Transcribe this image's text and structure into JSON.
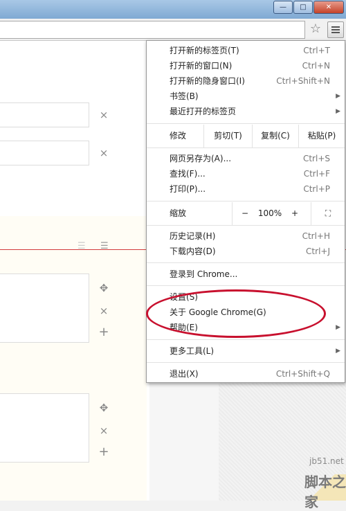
{
  "window": {
    "buttons": {
      "minimize": "—",
      "maximize": "□",
      "close": "✕"
    }
  },
  "toolbar": {
    "star_icon": "star-icon",
    "menu_icon": "hamburger-menu-icon"
  },
  "page": {
    "remove_glyph": "×",
    "add_glyph": "+",
    "move_glyph": "✥",
    "list_glyph": "☰"
  },
  "menu": {
    "items": [
      {
        "label": "打开新的标签页(T)",
        "shortcut": "Ctrl+T"
      },
      {
        "label": "打开新的窗口(N)",
        "shortcut": "Ctrl+N"
      },
      {
        "label": "打开新的隐身窗口(I)",
        "shortcut": "Ctrl+Shift+N"
      },
      {
        "label": "书签(B)",
        "submenu": "▶"
      },
      {
        "label": "最近打开的标签页",
        "submenu": "▶"
      }
    ],
    "edit": {
      "label": "修改",
      "cut": "剪切(T)",
      "copy": "复制(C)",
      "paste": "粘贴(P)"
    },
    "file_items": [
      {
        "label": "网页另存为(A)...",
        "shortcut": "Ctrl+S"
      },
      {
        "label": "查找(F)...",
        "shortcut": "Ctrl+F"
      },
      {
        "label": "打印(P)...",
        "shortcut": "Ctrl+P"
      }
    ],
    "zoom": {
      "label": "缩放",
      "minus": "−",
      "value": "100%",
      "plus": "+",
      "fullscreen": "⛶"
    },
    "history_items": [
      {
        "label": "历史记录(H)",
        "shortcut": "Ctrl+H"
      },
      {
        "label": "下载内容(D)",
        "shortcut": "Ctrl+J"
      }
    ],
    "signin": "登录到 Chrome...",
    "settings_items": [
      {
        "label": "设置(S)"
      },
      {
        "label": "关于 Google Chrome(G)"
      },
      {
        "label": "帮助(E)",
        "submenu": "▶"
      }
    ],
    "more_tools": {
      "label": "更多工具(L)",
      "submenu": "▶"
    },
    "exit": {
      "label": "退出(X)",
      "shortcut": "Ctrl+Shift+Q"
    }
  },
  "watermark": {
    "site": "jb51.net",
    "brand": "脚本之家"
  },
  "colors": {
    "highlight_ellipse": "#c8102e",
    "divider_line": "#d23b3b"
  }
}
